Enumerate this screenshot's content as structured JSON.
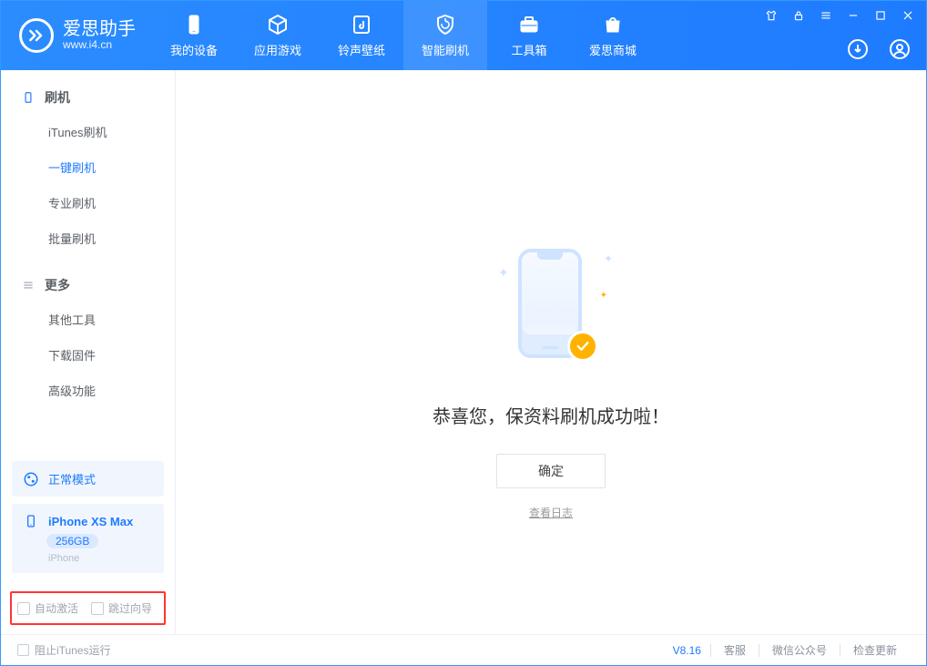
{
  "colors": {
    "primary": "#1e7bff",
    "accent": "#ffb300",
    "highlight_border": "#ff3434"
  },
  "app": {
    "name": "爱思助手",
    "url": "www.i4.cn"
  },
  "top_tabs": [
    {
      "id": "device",
      "label": "我的设备"
    },
    {
      "id": "apps",
      "label": "应用游戏"
    },
    {
      "id": "ringtone",
      "label": "铃声壁纸"
    },
    {
      "id": "flash",
      "label": "智能刷机",
      "active": true
    },
    {
      "id": "tools",
      "label": "工具箱"
    },
    {
      "id": "store",
      "label": "爱思商城"
    }
  ],
  "sidebar": {
    "sections": [
      {
        "title": "刷机",
        "icon": "phone",
        "items": [
          {
            "id": "itunes",
            "label": "iTunes刷机"
          },
          {
            "id": "onekey",
            "label": "一键刷机",
            "active": true
          },
          {
            "id": "pro",
            "label": "专业刷机"
          },
          {
            "id": "batch",
            "label": "批量刷机"
          }
        ]
      },
      {
        "title": "更多",
        "icon": "list",
        "items": [
          {
            "id": "other",
            "label": "其他工具"
          },
          {
            "id": "download",
            "label": "下载固件"
          },
          {
            "id": "advanced",
            "label": "高级功能"
          }
        ]
      }
    ],
    "mode": {
      "label": "正常模式"
    },
    "device": {
      "model": "iPhone XS Max",
      "capacity": "256GB",
      "subtype": "iPhone"
    },
    "checks": {
      "auto_activate": {
        "label": "自动激活",
        "checked": false
      },
      "skip_guide": {
        "label": "跳过向导",
        "checked": false
      }
    }
  },
  "main": {
    "success_text": "恭喜您，保资料刷机成功啦！",
    "confirm_label": "确定",
    "view_log_label": "查看日志"
  },
  "statusbar": {
    "block_itunes": {
      "label": "阻止iTunes运行",
      "checked": false
    },
    "version": "V8.16",
    "links": [
      "客服",
      "微信公众号",
      "检查更新"
    ]
  }
}
